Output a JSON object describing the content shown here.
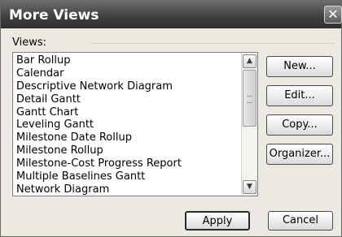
{
  "window": {
    "title": "More Views",
    "close_glyph": "✕"
  },
  "views": {
    "label": "Views:",
    "items": [
      "Bar Rollup",
      "Calendar",
      "Descriptive Network Diagram",
      "Detail Gantt",
      "Gantt Chart",
      "Leveling Gantt",
      "Milestone Date Rollup",
      "Milestone Rollup",
      "Milestone-Cost Progress Report",
      "Multiple Baselines Gantt",
      "Network Diagram"
    ]
  },
  "buttons": {
    "new": "New...",
    "edit": "Edit...",
    "copy": "Copy...",
    "organizer": "Organizer...",
    "apply": "Apply",
    "cancel": "Cancel"
  },
  "scrollbar": {
    "up_glyph": "▲",
    "down_glyph": "▼"
  }
}
